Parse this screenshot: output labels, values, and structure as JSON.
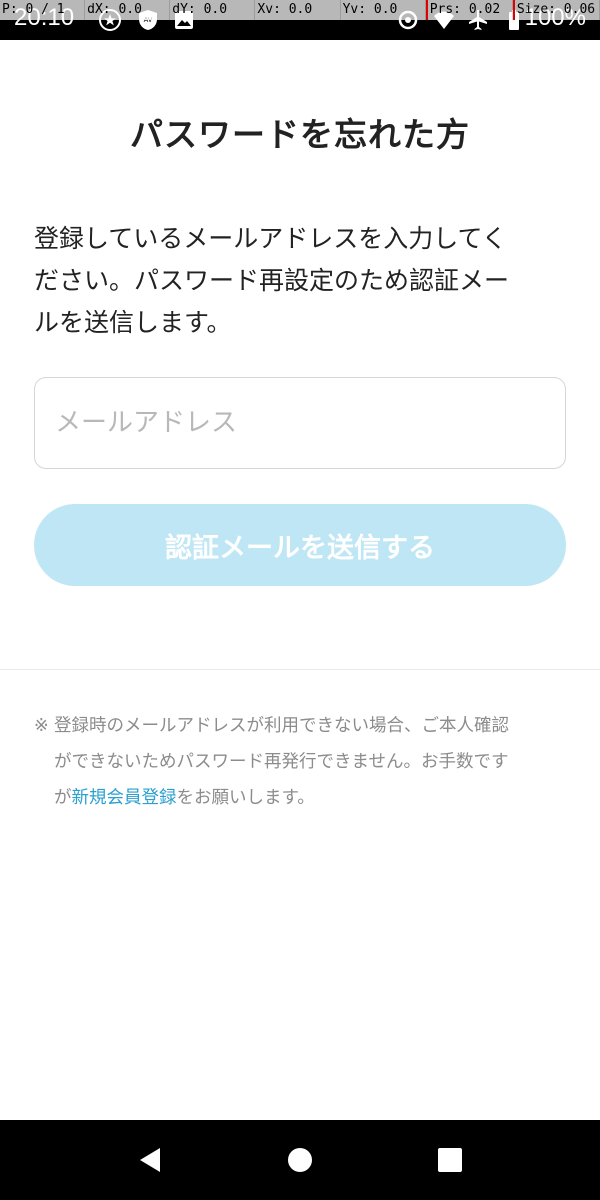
{
  "status_bar": {
    "time": "20:10",
    "battery": "100%",
    "icons": [
      "star-circle-icon",
      "av-shield-icon",
      "image-icon",
      "sync-icon",
      "wifi-icon",
      "airplane-icon",
      "battery-icon"
    ]
  },
  "debug_overlay": {
    "pointer": "P: 0 / 1",
    "dx": "dX: 0.0",
    "dy": "dY: 0.0",
    "xv": "Xv: 0.0",
    "yv": "Yv: 0.0",
    "prs": "Prs: 0.02",
    "size": "Size: 0.06"
  },
  "page": {
    "title": "パスワードを忘れた方",
    "instruction_lines": [
      "登録しているメールアドレスを入力してく",
      "ださい。パスワード再設定のため認証メー",
      "ルを送信します。"
    ],
    "email_placeholder": "メールアドレス",
    "email_value": "",
    "send_button": "認証メールを送信する",
    "note_mark": "※",
    "note_lines": [
      "登録時のメールアドレスが利用できない場合、ご本人確認",
      "ができないためパスワード再発行できません。お手数です"
    ],
    "note_prefix": "が",
    "note_link": "新規会員登録",
    "note_suffix": "をお願いします。"
  },
  "colors": {
    "accent": "#2a9fd0",
    "button_disabled": "#bfe6f4"
  }
}
